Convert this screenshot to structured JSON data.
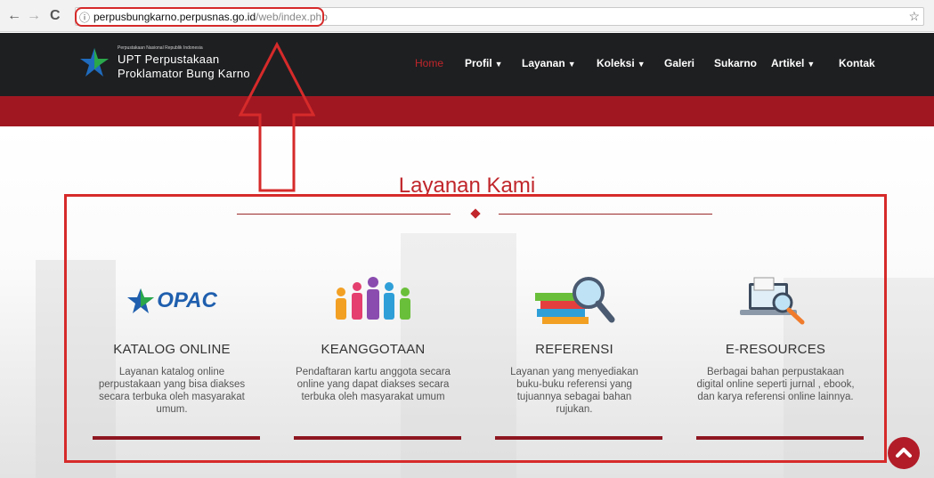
{
  "browser": {
    "back": "←",
    "forward": "→",
    "reload": "C",
    "info": "ⓘ",
    "url_host": "perpusbungkarno.perpusnas.go.id",
    "url_path": "/web/index.php",
    "star": "☆"
  },
  "header": {
    "logo_small": "Perpustakaan Nasional Republik Indonesia",
    "logo_line1": "UPT Perpustakaan",
    "logo_line2": "Proklamator Bung Karno"
  },
  "menu": {
    "home": "Home",
    "profil": "Profil",
    "layanan": "Layanan",
    "koleksi": "Koleksi",
    "galeri": "Galeri",
    "sukarno": "Sukarno",
    "artikel": "Artikel",
    "kontak": "Kontak",
    "caret": "▼"
  },
  "section": {
    "title": "Layanan Kami"
  },
  "cards": [
    {
      "logo_text": "OPAC",
      "title": "KATALOG ONLINE",
      "desc": "Layanan katalog online perpustakaan yang bisa diakses secara terbuka oleh masyarakat umum."
    },
    {
      "title": "KEANGGOTAAN",
      "desc": "Pendaftaran kartu anggota secara online yang dapat diakses secara terbuka oleh masyarakat umum"
    },
    {
      "title": "REFERENSI",
      "desc": "Layanan yang menyediakan buku-buku referensi yang tujuannya sebagai bahan rujukan."
    },
    {
      "title": "E-RESOURCES",
      "desc": "Berbagai bahan perpustakaan digital online seperti jurnal , ebook, dan karya referensi online lainnya."
    }
  ],
  "colors": {
    "accent": "#c0262b",
    "header_bg": "#1e1f21",
    "band": "#a01721",
    "annotation": "#d62a2a"
  }
}
